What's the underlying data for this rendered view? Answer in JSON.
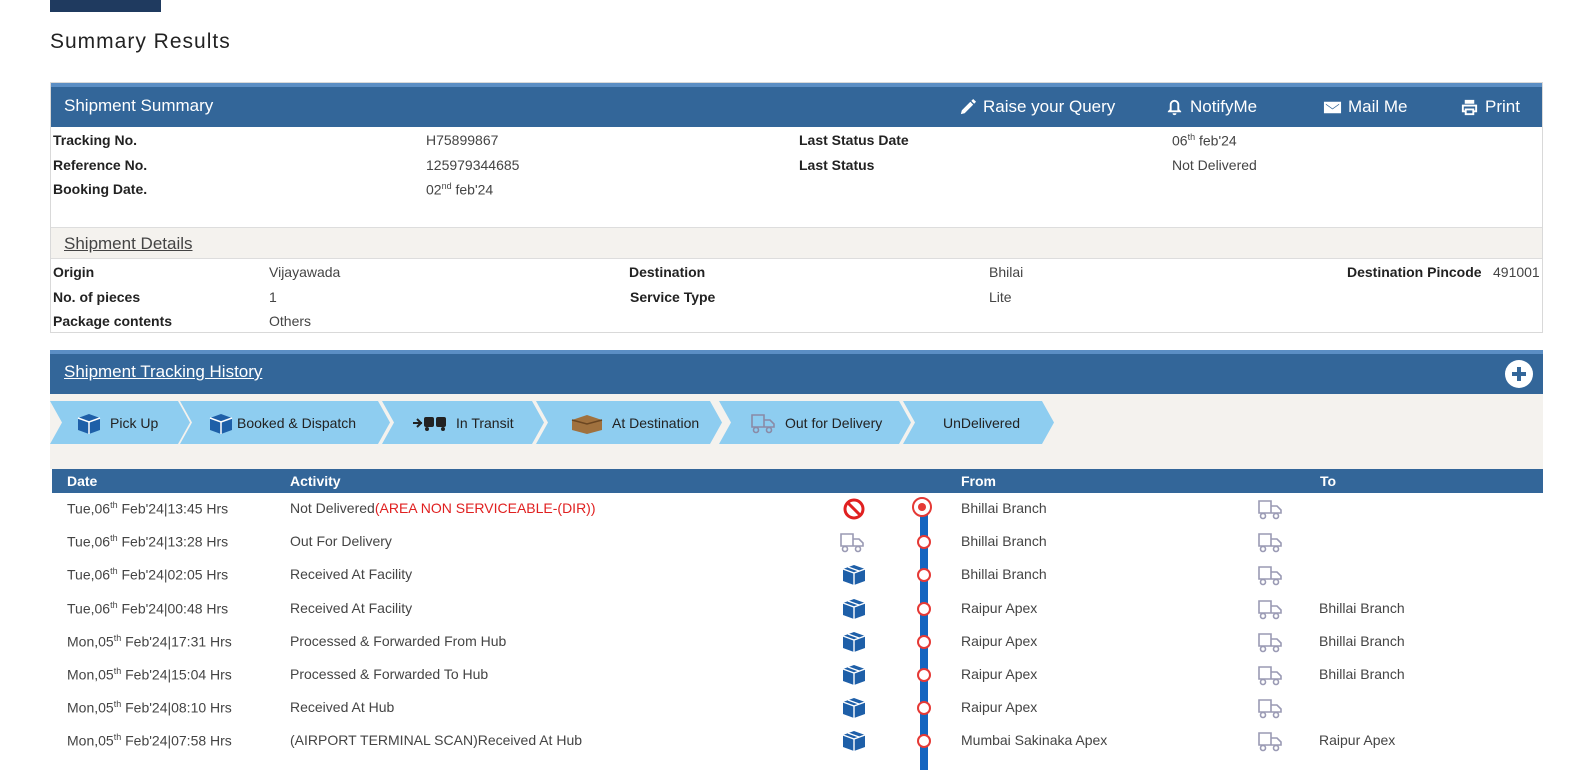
{
  "page": {
    "title": "Summary Results"
  },
  "summary": {
    "header": "Shipment Summary",
    "actions": [
      {
        "label": "Raise your Query",
        "icon": "pencil-icon"
      },
      {
        "label": "NotifyMe",
        "icon": "bell-icon"
      },
      {
        "label": "Mail Me",
        "icon": "envelope-icon"
      },
      {
        "label": "Print",
        "icon": "printer-icon"
      }
    ],
    "tracking_no_label": "Tracking No.",
    "tracking_no": "H75899867",
    "reference_no_label": "Reference No.",
    "reference_no": "125979344685",
    "booking_date_label": "Booking Date.",
    "booking_date_day": "02",
    "booking_date_suffix": "nd",
    "booking_date_rest": " feb'24",
    "last_status_date_label": "Last Status Date",
    "last_status_date_day": "06",
    "last_status_date_suffix": "th",
    "last_status_date_rest": " feb'24",
    "last_status_label": "Last Status",
    "last_status": "Not Delivered"
  },
  "details": {
    "header": "Shipment Details",
    "origin_label": "Origin",
    "origin": "Vijayawada",
    "destination_label": "Destination",
    "destination": "Bhilai",
    "pincode_label": "Destination Pincode",
    "pincode": "491001",
    "pieces_label": "No. of pieces",
    "pieces": "1",
    "service_label": "Service Type",
    "service": "Lite",
    "contents_label": "Package contents",
    "contents": "Others"
  },
  "history": {
    "header": "Shipment Tracking History",
    "steps": [
      {
        "label": "Pick Up",
        "icon": "package-icon"
      },
      {
        "label": "Booked & Dispatch",
        "icon": "package-icon"
      },
      {
        "label": "In Transit",
        "icon": "transport-icon"
      },
      {
        "label": "At Destination",
        "icon": "open-box-icon"
      },
      {
        "label": "Out for Delivery",
        "icon": "delivery-truck-icon"
      },
      {
        "label": "UnDelivered",
        "icon": ""
      }
    ],
    "columns": {
      "date": "Date",
      "activity": "Activity",
      "from": "From",
      "to": "To"
    },
    "rows": [
      {
        "day": "Tue,06",
        "sup": "th",
        "rest": " Feb'24|13:45 Hrs",
        "activity": "Not Delivered",
        "activity_note": "(AREA NON SERVICEABLE-(DIR))",
        "icon": "no-entry-icon",
        "from": "Bhillai Branch",
        "to": ""
      },
      {
        "day": "Tue,06",
        "sup": "th",
        "rest": " Feb'24|13:28 Hrs",
        "activity": "Out For Delivery",
        "activity_note": "",
        "icon": "delivery-truck-icon",
        "from": "Bhillai Branch",
        "to": ""
      },
      {
        "day": "Tue,06",
        "sup": "th",
        "rest": " Feb'24|02:05 Hrs",
        "activity": "Received At Facility",
        "activity_note": "",
        "icon": "package-icon",
        "from": "Bhillai Branch",
        "to": ""
      },
      {
        "day": "Tue,06",
        "sup": "th",
        "rest": " Feb'24|00:48 Hrs",
        "activity": "Received At Facility",
        "activity_note": "",
        "icon": "package-icon",
        "from": "Raipur Apex",
        "to": "Bhillai Branch"
      },
      {
        "day": "Mon,05",
        "sup": "th",
        "rest": " Feb'24|17:31 Hrs",
        "activity": "Processed & Forwarded From Hub",
        "activity_note": "",
        "icon": "package-icon",
        "from": "Raipur Apex",
        "to": "Bhillai Branch"
      },
      {
        "day": "Mon,05",
        "sup": "th",
        "rest": " Feb'24|15:04 Hrs",
        "activity": "Processed & Forwarded To Hub",
        "activity_note": "",
        "icon": "package-icon",
        "from": "Raipur Apex",
        "to": "Bhillai Branch"
      },
      {
        "day": "Mon,05",
        "sup": "th",
        "rest": " Feb'24|08:10 Hrs",
        "activity": "Received At Hub",
        "activity_note": "",
        "icon": "package-icon",
        "from": "Raipur Apex",
        "to": ""
      },
      {
        "day": "Mon,05",
        "sup": "th",
        "rest": " Feb'24|07:58 Hrs",
        "activity": "(AIRPORT TERMINAL SCAN)Received At Hub",
        "activity_note": "",
        "icon": "package-icon",
        "from": "Mumbai Sakinaka Apex",
        "to": "Raipur Apex"
      }
    ]
  }
}
